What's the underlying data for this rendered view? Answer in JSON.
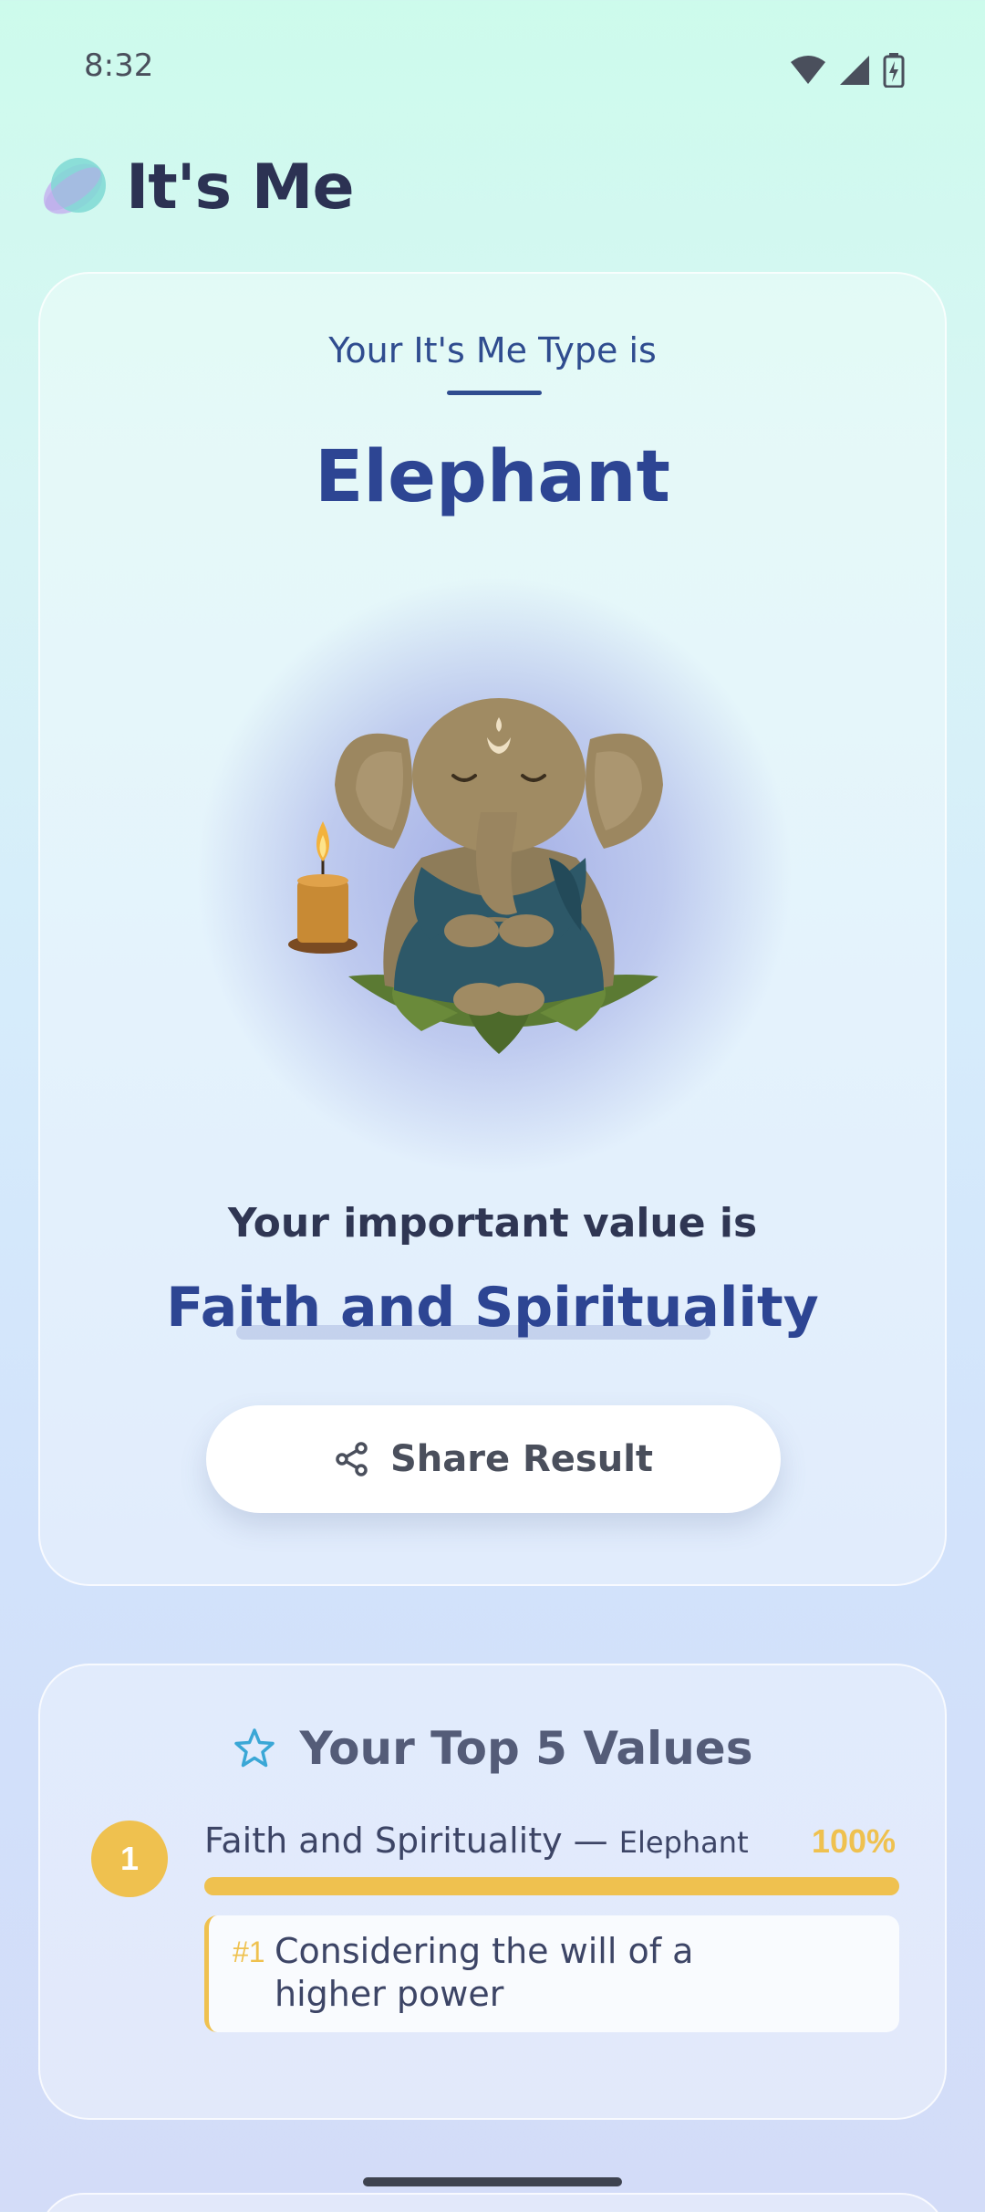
{
  "status_bar": {
    "time": "8:32"
  },
  "app": {
    "title": "It's Me"
  },
  "result": {
    "type_label": "Your It's Me Type is",
    "type_name": "Elephant",
    "value_intro": "Your important value is",
    "value_name": "Faith and Spirituality",
    "share_label": "Share Result"
  },
  "top_values": {
    "title": "Your Top 5 Values",
    "items": [
      {
        "rank": "1",
        "name": "Faith and Spirituality —",
        "animal": "Elephant",
        "percent_label": "100%",
        "percent": 100,
        "behavior_rank": "#1",
        "behavior": "Considering the will of a higher power"
      }
    ]
  },
  "colors": {
    "accent": "#2d4593",
    "gold": "#efc14f",
    "star": "#3aa7d6"
  },
  "icons": [
    "wifi-icon",
    "signal-icon",
    "battery-icon",
    "app-logo-icon",
    "share-icon",
    "star-icon",
    "elephant-mascot"
  ]
}
